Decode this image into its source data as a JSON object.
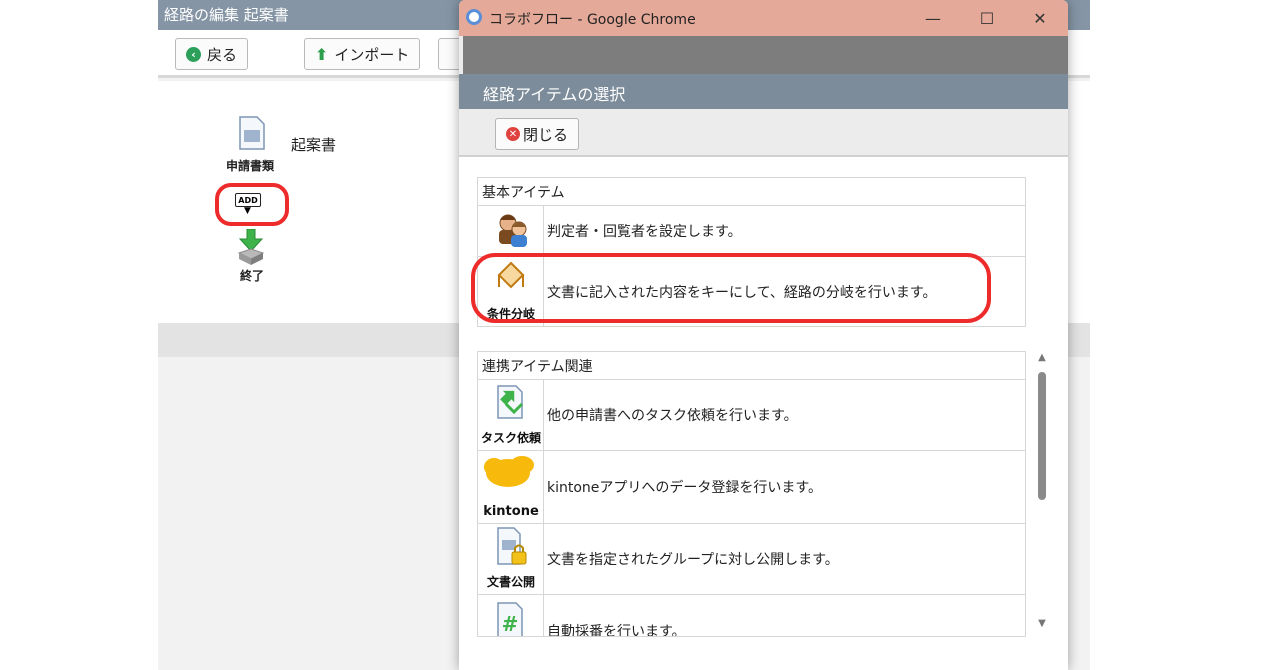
{
  "background_window": {
    "title": "経路の編集 起案書",
    "toolbar": {
      "back_label": "戻る",
      "import_label": "インポート"
    },
    "route": {
      "document_name": "起案書",
      "application_label": "申請書類",
      "add_label": "ADD",
      "end_label": "終了"
    }
  },
  "popup": {
    "window_title": "コラボフロー - Google Chrome",
    "dialog_title": "経路アイテムの選択",
    "close_label": "閉じる",
    "sections": [
      {
        "title": "基本アイテム",
        "items": [
          {
            "icon": "users-icon",
            "caption": "",
            "description": "判定者・回覧者を設定します。"
          },
          {
            "icon": "condition-branch-icon",
            "caption": "条件分岐",
            "description": "文書に記入された内容をキーにして、経路の分岐を行います。"
          }
        ]
      },
      {
        "title": "連携アイテム関連",
        "items": [
          {
            "icon": "task-request-icon",
            "caption": "タスク依頼",
            "description": "他の申請書へのタスク依頼を行います。"
          },
          {
            "icon": "kintone-icon",
            "caption": "kintone",
            "description": "kintoneアプリへのデータ登録を行います。"
          },
          {
            "icon": "document-publish-icon",
            "caption": "文書公開",
            "description": "文書を指定されたグループに対し公開します。"
          },
          {
            "icon": "auto-numbering-icon",
            "caption": "",
            "description": "自動採番を行います。"
          }
        ]
      }
    ]
  },
  "colors": {
    "highlight": "#ee2b2b",
    "dialog_header": "#7d8c9a",
    "chrome_bar": "#e4a998"
  }
}
